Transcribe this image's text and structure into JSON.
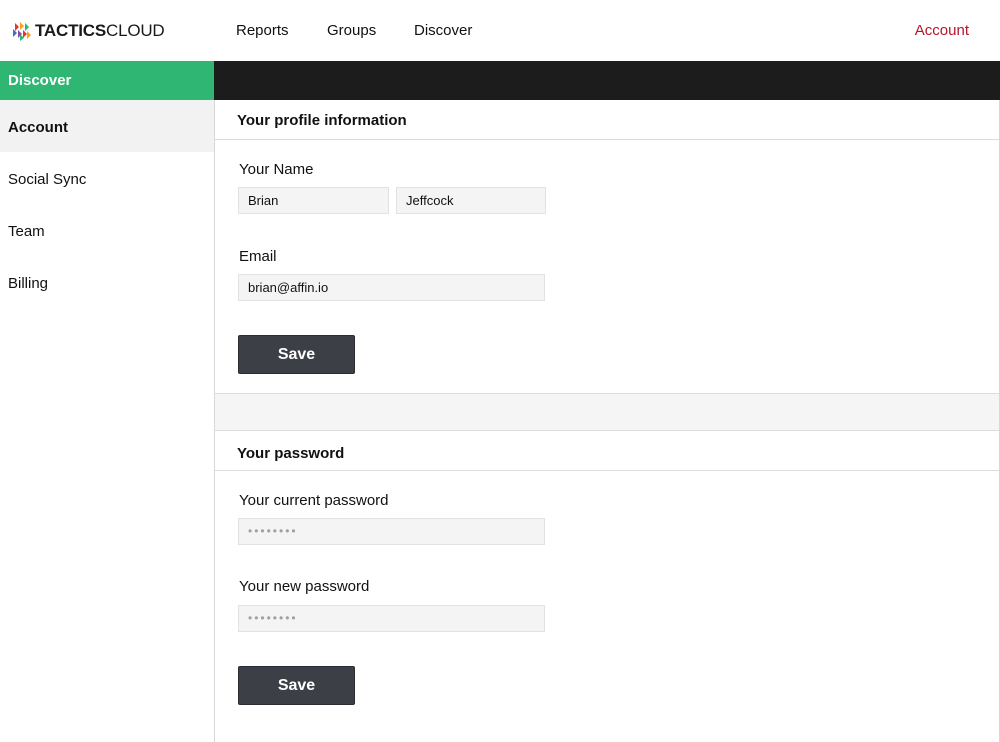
{
  "header": {
    "logo_bold": "TACTICS",
    "logo_light": "CLOUD",
    "nav": {
      "reports": "Reports",
      "groups": "Groups",
      "discover": "Discover",
      "account": "Account"
    }
  },
  "subbar": {
    "section": "Discover"
  },
  "sidebar": {
    "items": [
      {
        "label": "Account",
        "active": true
      },
      {
        "label": "Social Sync",
        "active": false
      },
      {
        "label": "Team",
        "active": false
      },
      {
        "label": "Billing",
        "active": false
      }
    ]
  },
  "profile": {
    "title": "Your profile information",
    "name_label": "Your Name",
    "first_name": "Brian",
    "last_name": "Jeffcock",
    "email_label": "Email",
    "email": "brian@affin.io",
    "save_label": "Save"
  },
  "password": {
    "title": "Your password",
    "current_label": "Your current password",
    "current_value": "••••••••",
    "new_label": "Your new password",
    "new_value": "••••••••",
    "save_label": "Save"
  },
  "colors": {
    "accent_green": "#2fb673",
    "dark_bar": "#1c1c1c",
    "account_link": "#b5162d",
    "button": "#3d3f47"
  }
}
